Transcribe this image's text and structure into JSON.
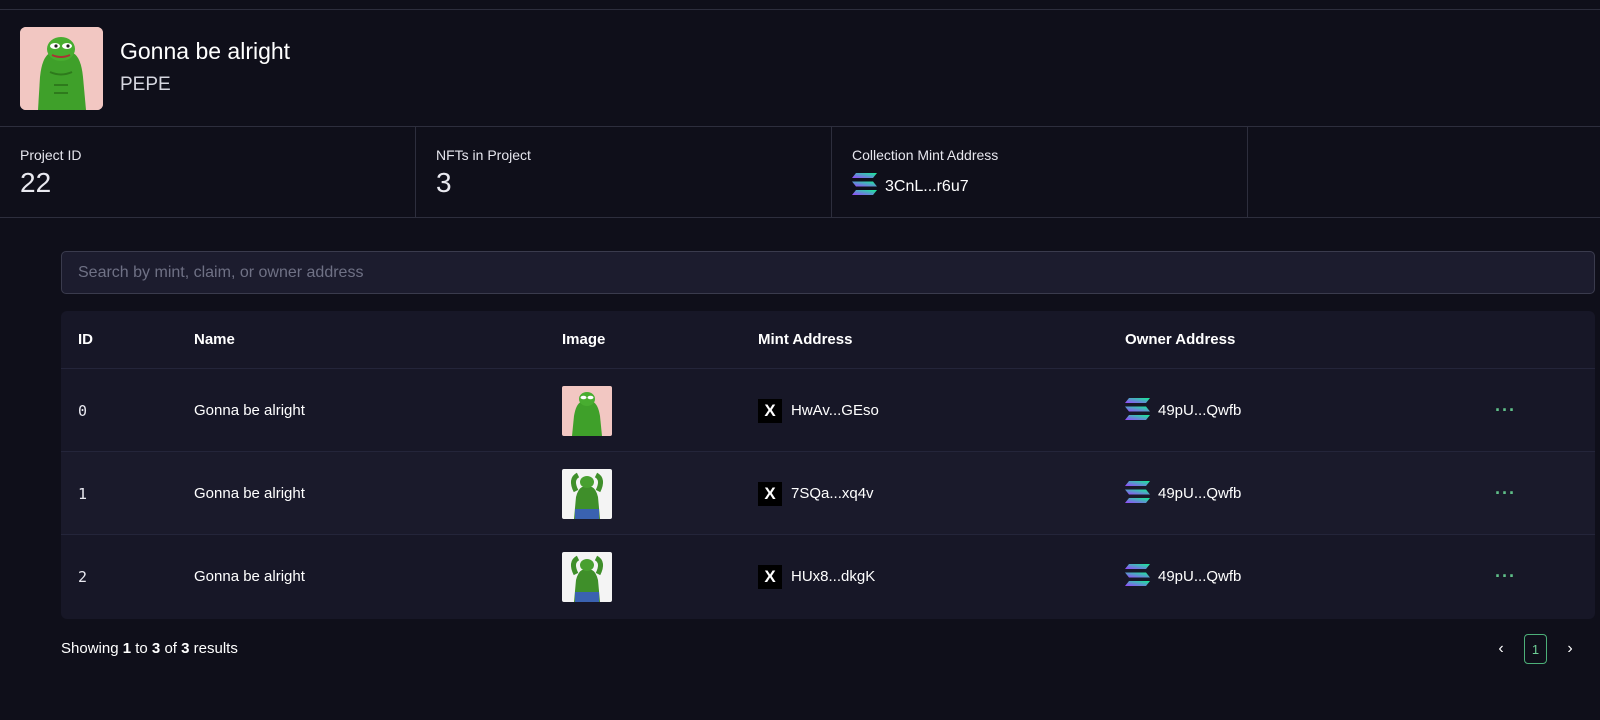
{
  "project": {
    "title": "Gonna be alright",
    "symbol": "PEPE"
  },
  "stats": [
    {
      "label": "Project ID",
      "value": "22"
    },
    {
      "label": "NFTs in Project",
      "value": "3"
    },
    {
      "label": "Collection Mint Address",
      "value": "3CnL...r6u7"
    }
  ],
  "search": {
    "placeholder": "Search by mint, claim, or owner address",
    "value": ""
  },
  "table": {
    "columns": [
      "ID",
      "Name",
      "Image",
      "Mint Address",
      "Owner Address"
    ],
    "rows": [
      {
        "id": "0",
        "name": "Gonna be alright",
        "mint": "HwAv...GEso",
        "owner": "49pU...Qwfb"
      },
      {
        "id": "1",
        "name": "Gonna be alright",
        "mint": "7SQa...xq4v",
        "owner": "49pU...Qwfb"
      },
      {
        "id": "2",
        "name": "Gonna be alright",
        "mint": "HUx8...dkgK",
        "owner": "49pU...Qwfb"
      }
    ],
    "row_menu_label": "···",
    "mint_badge": "X"
  },
  "pagination": {
    "showing": "Showing",
    "from": "1",
    "to_word": "to",
    "to": "3",
    "of_word": "of",
    "total": "3",
    "results_word": "results",
    "current_page": "1",
    "prev": "‹",
    "next": "›"
  },
  "colors": {
    "background": "#0f0f1a",
    "panel": "#171727",
    "accent": "#4caf78",
    "solana_gradient": [
      "#00ffa3",
      "#dc1fff"
    ]
  }
}
